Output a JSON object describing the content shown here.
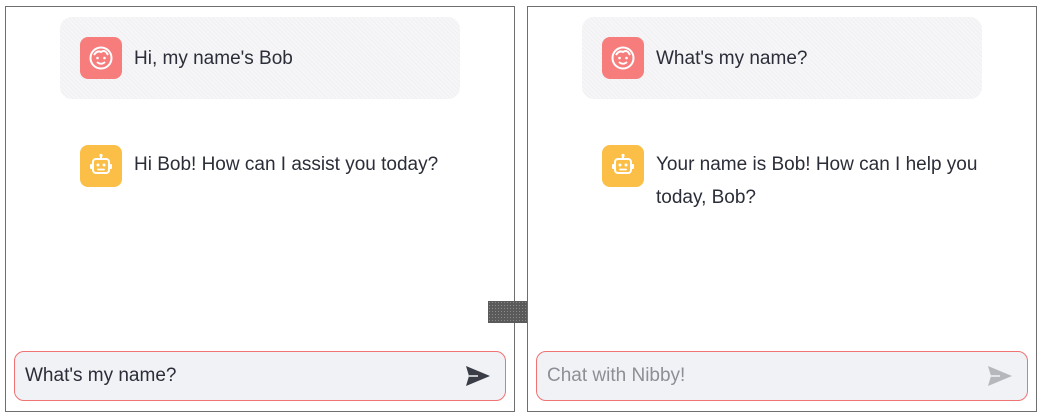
{
  "before": {
    "messages": [
      {
        "role": "user",
        "avatar_icon": "user-face-icon",
        "text": "Hi, my name's Bob"
      },
      {
        "role": "assistant",
        "avatar_icon": "robot-icon",
        "text": "Hi Bob! How can I assist you today?"
      }
    ],
    "input": {
      "value": "What's my name?",
      "placeholder": ""
    }
  },
  "after": {
    "messages": [
      {
        "role": "user",
        "avatar_icon": "user-face-icon",
        "text": "What's my name?"
      },
      {
        "role": "assistant",
        "avatar_icon": "robot-icon",
        "text": "Your name is Bob! How can I help you today, Bob?"
      }
    ],
    "input": {
      "value": "",
      "placeholder": "Chat with Nibby!"
    }
  },
  "colors": {
    "user_avatar": "#f77d7d",
    "bot_avatar": "#fbbf47",
    "input_border": "#ef7373",
    "input_background": "#f0f2f6",
    "send_active": "#3a3d46",
    "send_inactive": "#b5b7bd"
  }
}
